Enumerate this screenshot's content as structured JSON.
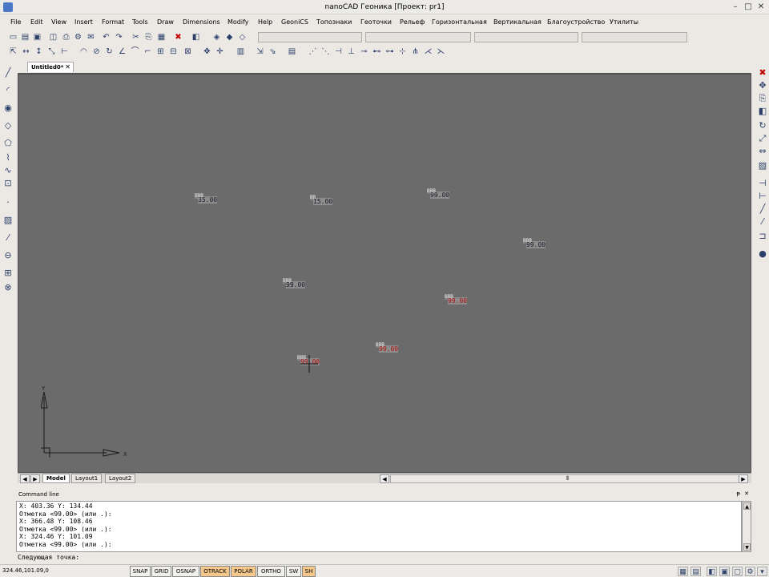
{
  "window": {
    "title": "nanoCAD Геоника [Проект: pr1]"
  },
  "menu": [
    "File",
    "Edit",
    "View",
    "Insert",
    "Format",
    "Tools",
    "Draw",
    "Dimensions",
    "Modify",
    "Help",
    "GeoniCS",
    "Топознаки",
    "Геоточки",
    "Рельеф",
    "Горизонтальная",
    "Вертикальная",
    "Благоустройство",
    "Утилиты"
  ],
  "doc_tab": "Untitled0*",
  "layout_tabs": [
    "Model",
    "Layout1",
    "Layout2"
  ],
  "ucs": {
    "x_label": "X",
    "y_label": "Y"
  },
  "points": [
    {
      "height_text": "ВВВ",
      "value": "35.00",
      "color": "dark"
    },
    {
      "height_text": "ВВ",
      "value": "15.00",
      "color": "dark"
    },
    {
      "height_text": "ВВВ",
      "value": "99.00",
      "color": "dark"
    },
    {
      "height_text": "ВВВ",
      "value": "99.00",
      "color": "dark"
    },
    {
      "height_text": "ВВВ",
      "value": "99.00",
      "color": "dark"
    },
    {
      "height_text": "ВВВ",
      "value": "99.00",
      "color": "red"
    },
    {
      "height_text": "ВВВ",
      "value": "99.00",
      "color": "red"
    },
    {
      "height_text": "ВВВ",
      "value": "99.00",
      "color": "red"
    }
  ],
  "command": {
    "header": "Command line",
    "lines": [
      "X: 403.36 Y: 134.44",
      "Отметка <99.00> (или .):",
      "X: 366.48 Y: 108.46",
      "Отметка <99.00> (или .):",
      "X: 324.46 Y: 101.09",
      "Отметка <99.00> (или .):"
    ],
    "prompt": "Следующая точка:"
  },
  "status": {
    "coords": "324.46,101.09,0",
    "buttons": [
      {
        "label": "SNAP",
        "on": false
      },
      {
        "label": "GRID",
        "on": false
      },
      {
        "label": "OSNAP",
        "on": false
      },
      {
        "label": "OTRACK",
        "on": true
      },
      {
        "label": "POLAR",
        "on": true
      },
      {
        "label": "ORTHO",
        "on": false
      },
      {
        "label": "SW",
        "on": false
      },
      {
        "label": "SH",
        "on": true
      }
    ]
  },
  "icons": [
    "new-file-icon",
    "open-icon",
    "save-icon",
    "print-icon",
    "cut-icon",
    "copy-icon",
    "paste-icon",
    "delete-icon",
    "undo-icon",
    "redo-icon",
    "line-icon",
    "arc-icon",
    "circle-icon",
    "polygon-icon",
    "hatch-icon",
    "erase-icon",
    "move-icon",
    "rotate-icon",
    "scale-icon",
    "mirror-icon"
  ]
}
